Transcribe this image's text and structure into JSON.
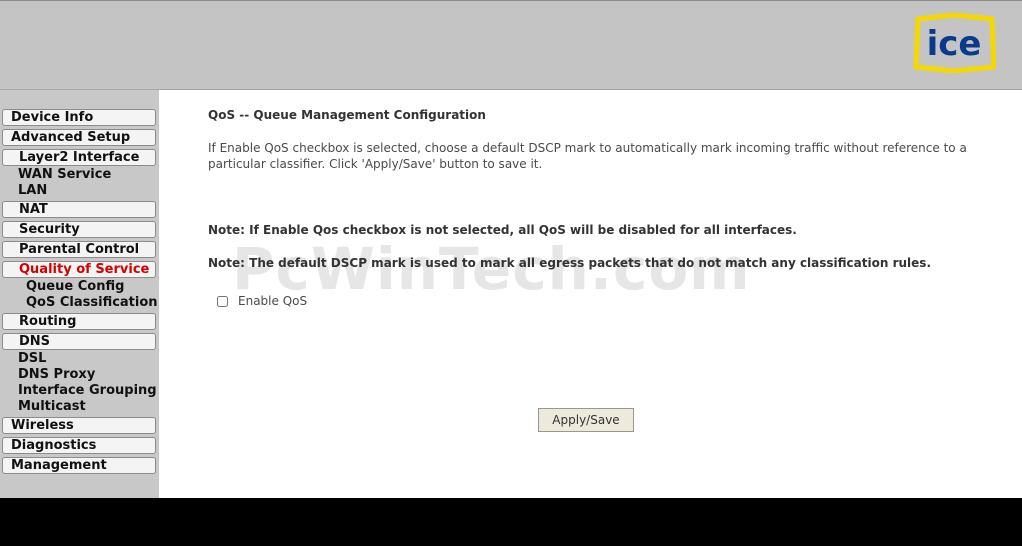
{
  "brand": {
    "logo_text": "ice",
    "accent": "#f5d800",
    "logo_color": "#0a3a8c"
  },
  "sidebar": {
    "items": [
      {
        "label": "Device Info"
      },
      {
        "label": "Advanced Setup"
      },
      {
        "label": "Layer2 Interface"
      },
      {
        "label": "WAN Service"
      },
      {
        "label": "LAN"
      },
      {
        "label": "NAT"
      },
      {
        "label": "Security"
      },
      {
        "label": "Parental Control"
      },
      {
        "label": "Quality of Service",
        "active": true
      },
      {
        "label": "Queue Config"
      },
      {
        "label": "QoS Classification"
      },
      {
        "label": "Routing"
      },
      {
        "label": "DNS"
      },
      {
        "label": "DSL"
      },
      {
        "label": "DNS Proxy"
      },
      {
        "label": "Interface Grouping"
      },
      {
        "label": "Multicast"
      },
      {
        "label": "Wireless"
      },
      {
        "label": "Diagnostics"
      },
      {
        "label": "Management"
      }
    ]
  },
  "main": {
    "title": "QoS -- Queue Management Configuration",
    "description": "If Enable QoS checkbox is selected, choose a default DSCP mark to automatically mark incoming traffic without reference to a particular classifier. Click 'Apply/Save' button to save it.",
    "note1": "Note: If Enable Qos checkbox is not selected, all QoS will be disabled for all interfaces.",
    "note2": "Note: The default DSCP mark is used to mark all egress packets that do not match any classification rules.",
    "enable_qos_label": "Enable QoS",
    "enable_qos_checked": false,
    "apply_label": "Apply/Save"
  },
  "watermark": "PcWinTech.com"
}
